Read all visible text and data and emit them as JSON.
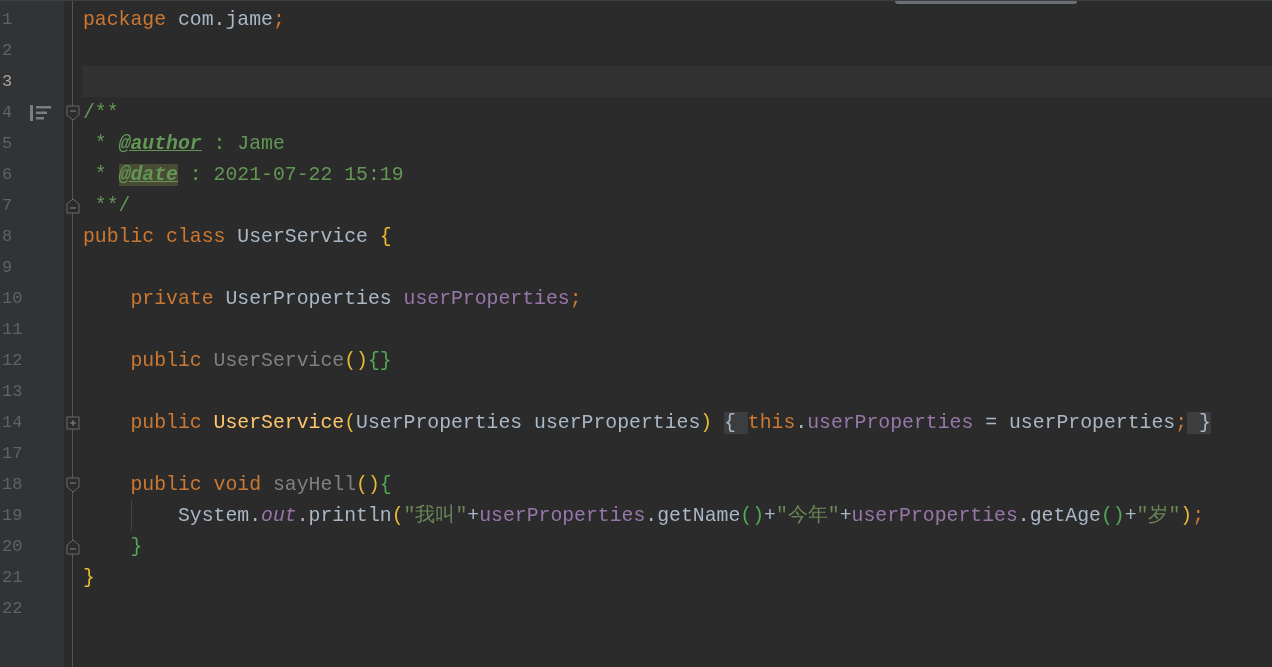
{
  "editor": {
    "lines": [
      {
        "number": "1",
        "current": false,
        "tokens": [
          {
            "kind": "kw",
            "t": "package "
          },
          {
            "kind": "id",
            "t": "com.jame"
          },
          {
            "kind": "kw",
            "t": ";"
          }
        ]
      },
      {
        "number": "2",
        "current": false
      },
      {
        "number": "3",
        "current": true
      },
      {
        "number": "4",
        "current": false,
        "fold": {
          "kind": "start"
        },
        "gutter_icon": {
          "kind": "doc"
        },
        "tokens": [
          {
            "kind": "doc",
            "t": "/**"
          }
        ]
      },
      {
        "number": "5",
        "current": false,
        "tokens": [
          {
            "kind": "doc",
            "t": " * "
          },
          {
            "kind": "tag",
            "t": "@author"
          },
          {
            "kind": "doc",
            "t": " : Jame"
          }
        ]
      },
      {
        "number": "6",
        "current": false,
        "tokens": [
          {
            "kind": "doc",
            "t": " * "
          },
          {
            "kind": "tagmatch",
            "t": "@date"
          },
          {
            "kind": "doc",
            "t": " : 2021-07-22 15:19"
          }
        ]
      },
      {
        "number": "7",
        "current": false,
        "fold": {
          "kind": "end"
        },
        "tokens": [
          {
            "kind": "doc",
            "t": " **/"
          }
        ]
      },
      {
        "number": "8",
        "current": false,
        "tokens": [
          {
            "kind": "kw",
            "t": "public class "
          },
          {
            "kind": "id",
            "t": "UserService "
          },
          {
            "kind": "yellow",
            "t": "{"
          }
        ]
      },
      {
        "number": "9",
        "current": false
      },
      {
        "number": "10",
        "current": false,
        "tokens": [
          {
            "kind": "kw",
            "t": "    private "
          },
          {
            "kind": "id",
            "t": "UserProperties "
          },
          {
            "kind": "field",
            "t": "userProperties"
          },
          {
            "kind": "kw",
            "t": ";"
          }
        ]
      },
      {
        "number": "11",
        "current": false
      },
      {
        "number": "12",
        "current": false,
        "tokens": [
          {
            "kind": "kw",
            "t": "    public "
          },
          {
            "kind": "unused",
            "t": "UserService"
          },
          {
            "kind": "yellow",
            "t": "()"
          },
          {
            "kind": "green",
            "t": "{}"
          }
        ]
      },
      {
        "number": "13",
        "current": false
      },
      {
        "number": "14",
        "current": false,
        "fold": {
          "kind": "folded"
        },
        "tokens": [
          {
            "kind": "kw",
            "t": "    public "
          },
          {
            "kind": "decl",
            "t": "UserService"
          },
          {
            "kind": "yellow",
            "t": "("
          },
          {
            "kind": "id",
            "t": "UserProperties userProperties"
          },
          {
            "kind": "yellow",
            "t": ") "
          },
          {
            "kind": "fold",
            "t": "{ "
          },
          {
            "kind": "kw",
            "t": "this"
          },
          {
            "kind": "id",
            "t": "."
          },
          {
            "kind": "field",
            "t": "userProperties"
          },
          {
            "kind": "id",
            "t": " = userProperties"
          },
          {
            "kind": "kw",
            "t": ";"
          },
          {
            "kind": "fold",
            "t": " }"
          }
        ]
      },
      {
        "number": "17",
        "current": false
      },
      {
        "number": "18",
        "current": false,
        "fold": {
          "kind": "start"
        },
        "tokens": [
          {
            "kind": "kw",
            "t": "    public void "
          },
          {
            "kind": "unused",
            "t": "sayHell"
          },
          {
            "kind": "yellow",
            "t": "()"
          },
          {
            "kind": "green",
            "t": "{"
          }
        ]
      },
      {
        "number": "19",
        "current": false,
        "guide": true,
        "tokens": [
          {
            "kind": "id",
            "t": "        System."
          },
          {
            "kind": "static",
            "t": "out"
          },
          {
            "kind": "id",
            "t": ".println"
          },
          {
            "kind": "yellow",
            "t": "("
          },
          {
            "kind": "str",
            "t": "\"我叫\""
          },
          {
            "kind": "id",
            "t": "+"
          },
          {
            "kind": "field",
            "t": "userProperties"
          },
          {
            "kind": "id",
            "t": ".getName"
          },
          {
            "kind": "green",
            "t": "()"
          },
          {
            "kind": "id",
            "t": "+"
          },
          {
            "kind": "str",
            "t": "\"今年\""
          },
          {
            "kind": "id",
            "t": "+"
          },
          {
            "kind": "field",
            "t": "userProperties"
          },
          {
            "kind": "id",
            "t": ".getAge"
          },
          {
            "kind": "green",
            "t": "()"
          },
          {
            "kind": "id",
            "t": "+"
          },
          {
            "kind": "str",
            "t": "\"岁\""
          },
          {
            "kind": "yellow",
            "t": ")"
          },
          {
            "kind": "kw",
            "t": ";"
          }
        ]
      },
      {
        "number": "20",
        "current": false,
        "fold": {
          "kind": "end"
        },
        "tokens": [
          {
            "kind": "green",
            "t": "    }"
          }
        ]
      },
      {
        "number": "21",
        "current": false,
        "tokens": [
          {
            "kind": "yellow",
            "t": "}"
          }
        ]
      },
      {
        "number": "22",
        "current": false
      }
    ]
  }
}
